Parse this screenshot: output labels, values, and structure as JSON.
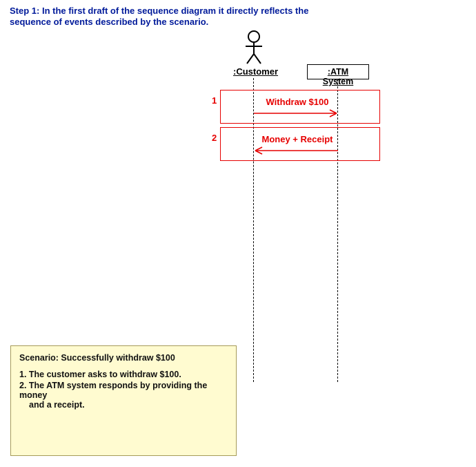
{
  "step_text": "Step 1: In the first draft of the sequence diagram it directly reflects the sequence of events described by the scenario.",
  "actors": {
    "customer": ":Customer",
    "atm": ":ATM System"
  },
  "messages": {
    "m1": {
      "num": "1",
      "label": "Withdraw $100"
    },
    "m2": {
      "num": "2",
      "label": "Money + Receipt"
    }
  },
  "scenario": {
    "title": "Scenario:  Successfully withdraw $100",
    "item1": "1. The customer asks to withdraw $100.",
    "item2_a": "2. The ATM system responds by providing the money",
    "item2_b": "and a receipt."
  }
}
